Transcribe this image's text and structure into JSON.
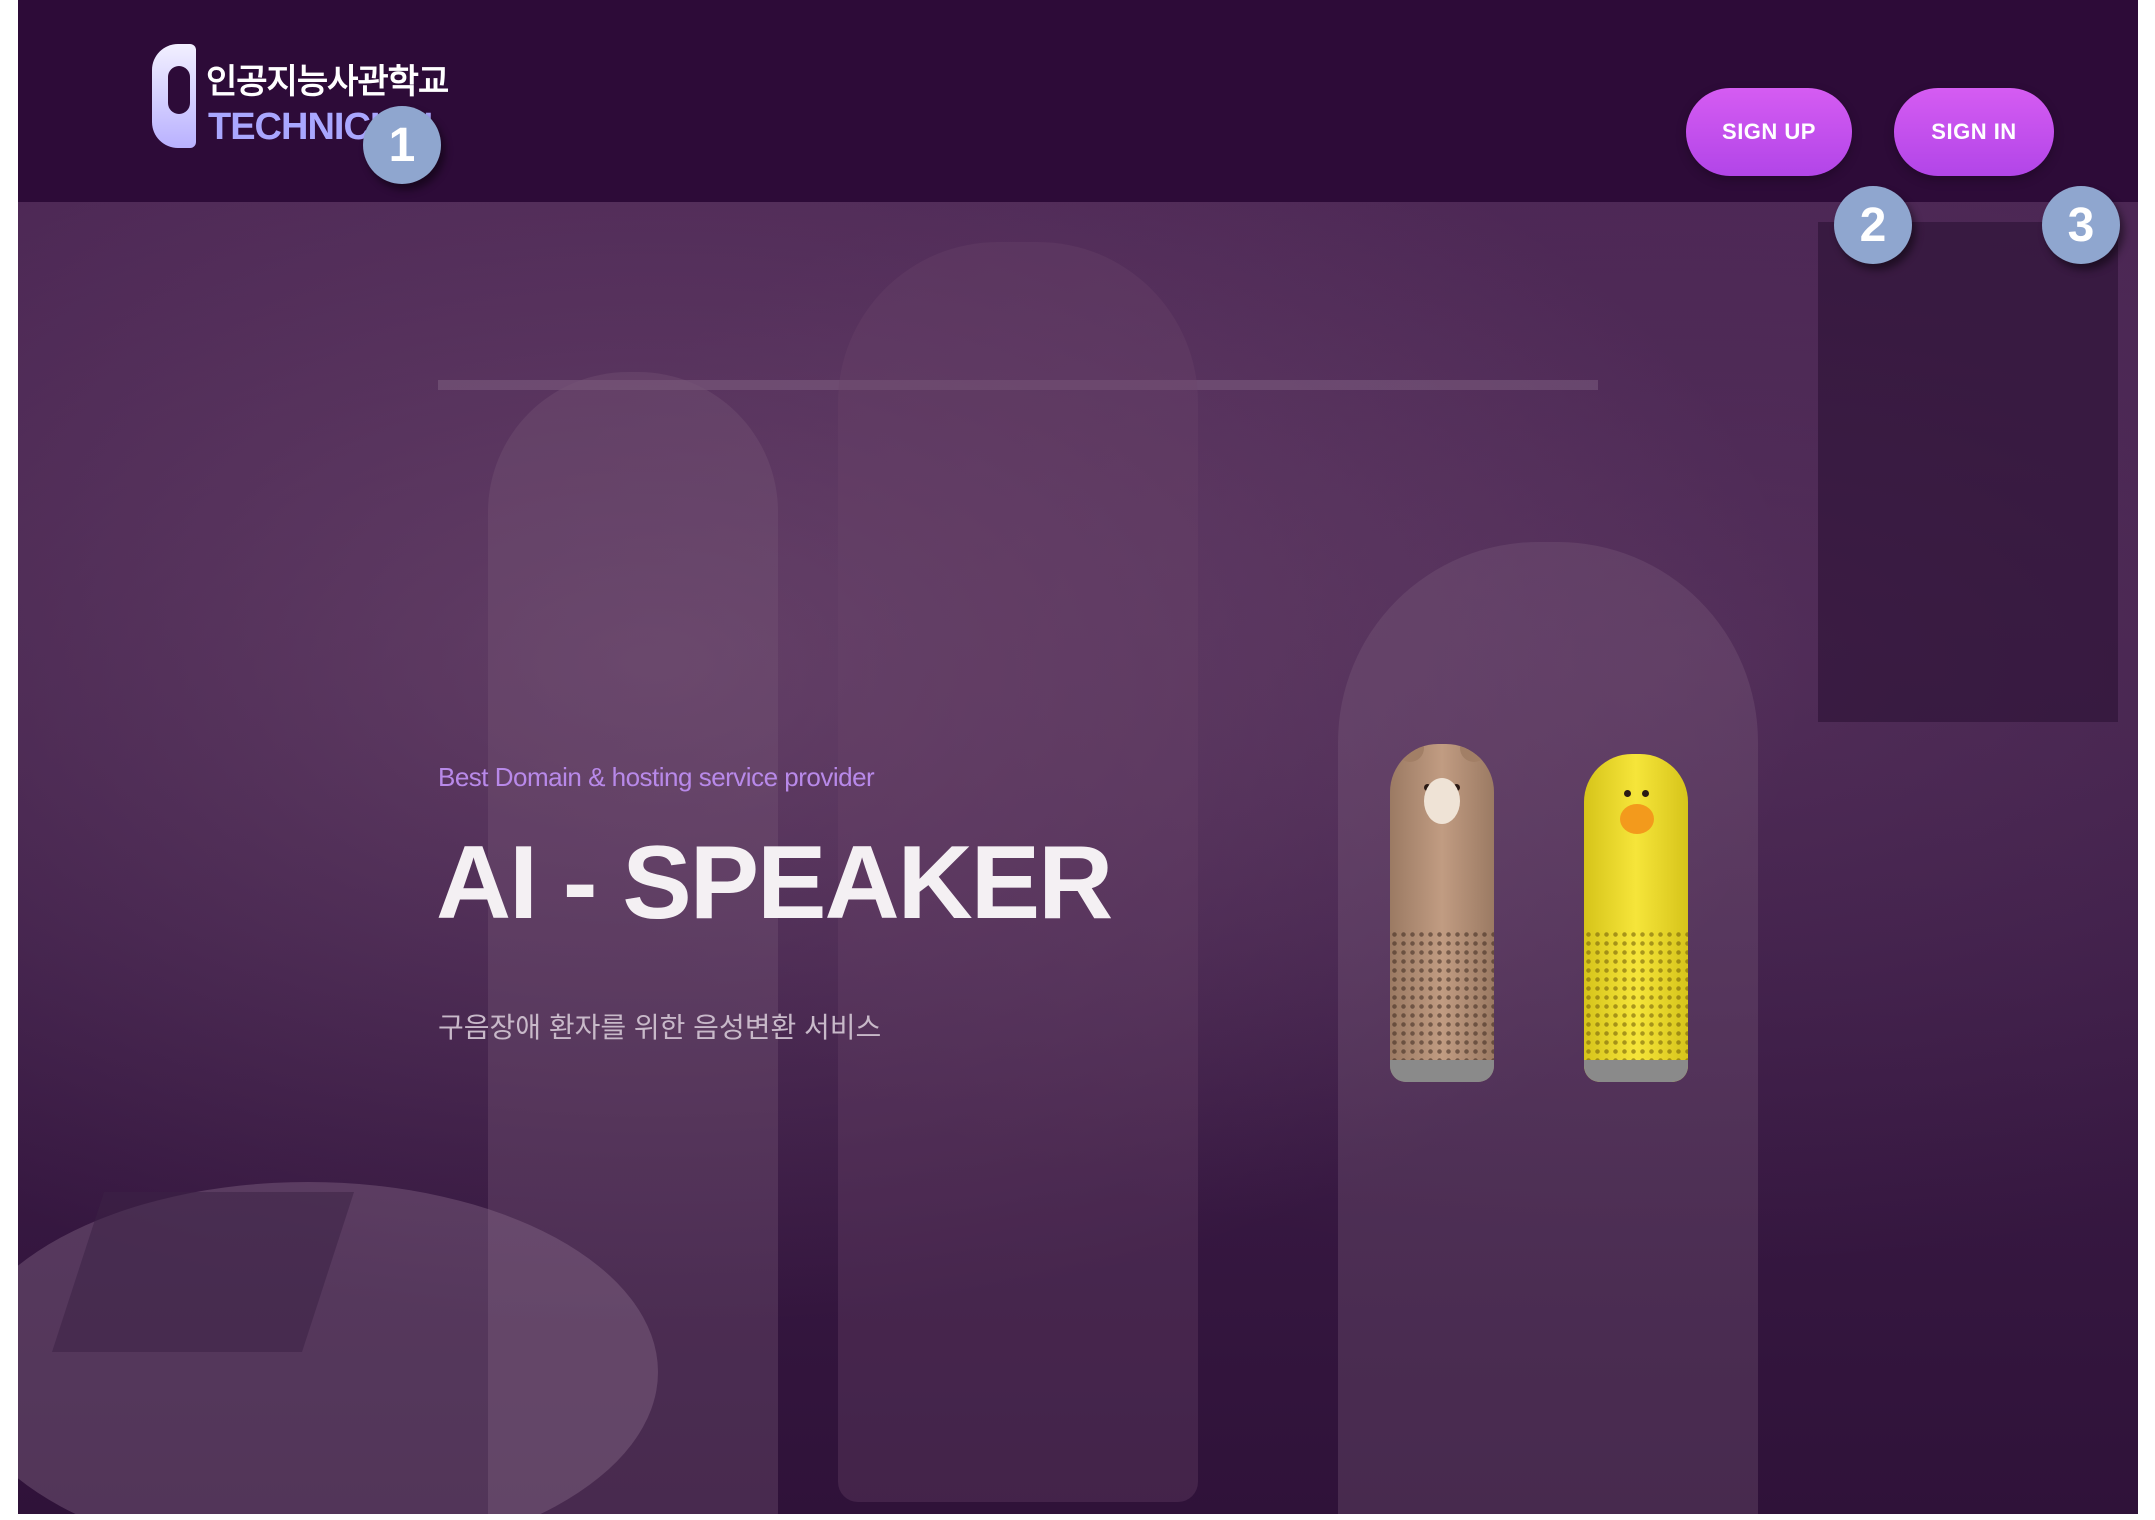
{
  "header": {
    "logo_korean": "인공지능사관학교",
    "logo_english": "TECHNICIAN",
    "signup_label": "SIGN UP",
    "signin_label": "SIGN IN"
  },
  "markers": [
    "1",
    "2",
    "3"
  ],
  "hero": {
    "eyebrow": "Best Domain & hosting service provider",
    "title": "AI - SPEAKER",
    "subtitle": "구음장애 환자를 위한 음성변환 서비스"
  },
  "colors": {
    "header_bg": "#2d0b38",
    "button": "#c550ee",
    "eyebrow": "#b889e9",
    "marker": "#8fa6cf"
  },
  "icons": [
    "logo-mark-icon",
    "bear-speaker-image",
    "chick-speaker-image"
  ]
}
